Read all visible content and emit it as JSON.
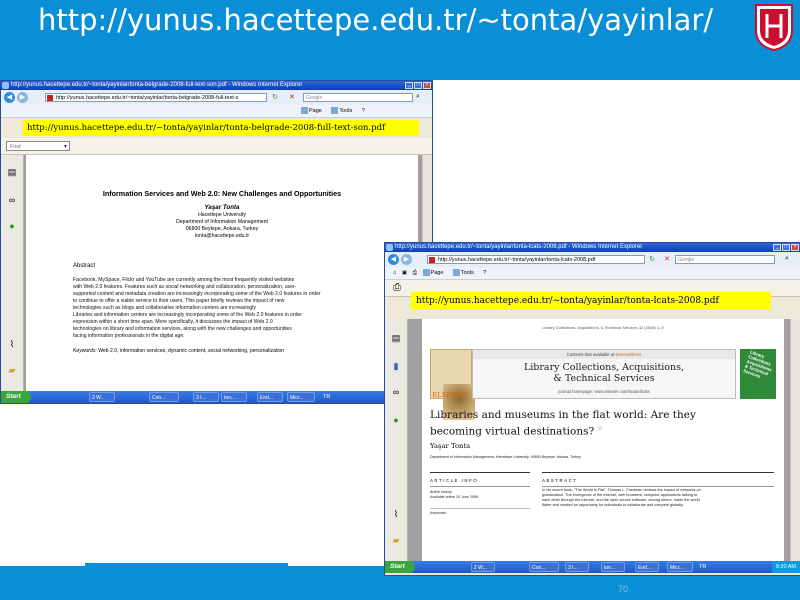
{
  "slide": {
    "title": "http://yunus.hacettepe.edu.tr/~tonta/yayinlar/",
    "page_number": "70"
  },
  "colors": {
    "header_blue": "#0a8ed6",
    "banner_yellow": "#ffff00",
    "logo_red": "#c8102e"
  },
  "window1": {
    "title": "http://yunus.hacettepe.edu.tr/~tonta/yayinlar/tonta-belgrade-2008-full-text-son.pdf - Windows Internet Explorer",
    "address": "http://yunus.hacettepe.edu.tr/~tonta/yayinlar/tonta-belgrade-2008-full-text-s",
    "search_placeholder": "Google",
    "banner_url": "http://yunus.hacettepe.edu.tr/~tonta/yayinlar/tonta-belgrade-2008-full-text-son.pdf",
    "find_placeholder": "Find",
    "toolbar": {
      "page": "Page",
      "tools": "Tools"
    },
    "paper": {
      "title": "Information Services and Web 2.0: New Challenges and Opportunities",
      "author": "Yaşar Tonta",
      "affiliation": [
        "Hacettepe University",
        "Department of Information Management",
        "06800 Beytepe, Ankara, Turkey",
        "tonta@hacettepe.edu.tr"
      ],
      "abstract_heading": "Abstract",
      "abstract_lines": [
        "Facebook, MySpace, Flickr and YouTube are currently among the most frequently visited websites",
        "with Web 2.0 features.  Features such as social networking and collaboration, personalization, user-",
        "supported content and metadata creation are increasingly incorporating some of the Web 2.0 features in order",
        "to continue to offer a viable service to their users.  This paper briefly reviews the impact of new",
        "technologies such as blogs and collaborative information centers are increasingly",
        "Libraries and information centers are increasingly incorporating some of the Web 2.0 features in order",
        "expression within a short time span.  More specifically, it discusses the impact of Web 2.0",
        "technologies on library and information services, along with the new challenges and opportunities",
        "facing information professionals in the digital age."
      ],
      "keywords_label": "Keywords:",
      "keywords": "Web 2.0, information services, dynamic content, social networking, personalization"
    },
    "taskbar": {
      "start": "Start",
      "items": [
        "2 W...",
        "Con...",
        "3 I...",
        "ton...",
        "End...",
        "Micr..."
      ],
      "lang": "TR"
    }
  },
  "window2": {
    "title": "http://yunus.hacettepe.edu.tr/~tonta/yayinlar/tonta-lcats-2008.pdf - Windows Internet Explorer",
    "address": "http://yunus.hacettepe.edu.tr/~tonta/yayinlar/tonta-lcats-2008.pdf",
    "search_placeholder": "Google",
    "banner_url": "http://yunus.hacettepe.edu.tr/~tonta/yayinlar/tonta-lcats-2008.pdf",
    "toolbar": {
      "page": "Page",
      "tools": "Tools"
    },
    "article": {
      "journal_ref": "Library Collections, Acquisitions, & Technical Services 32 (2008) 1–9",
      "contents_prefix": "Contents lists available at",
      "contents_link": "ScienceDirect",
      "journal_title_line1": "Library Collections, Acquisitions,",
      "journal_title_line2": "& Technical Services",
      "journal_homepage": "journal homepage: www.elsevier.com/locate/lcats",
      "publisher": "ELSEVIER",
      "cover_text": "Library Collections Acquisitions & Technical Services",
      "title": "Libraries and museums in the flat world: Are they becoming virtual destinations?",
      "title_mark": "☆",
      "author": "Yaşar Tonta",
      "department": "Department of Information Management, Hacettepe University, 06800 Beytepe, Ankara, Turkey",
      "article_info_label": "ARTICLE   INFO",
      "abstract_label": "ABSTRACT",
      "history": [
        "Article history:",
        "Available online 24 June 2008"
      ],
      "keywords_label": "Keywords:",
      "abstract_lines": [
        "In his recent book, \"The World is Flat\", Thomas L. Friedman reviews the impact of networks on",
        "globalization. The emergence of the Internet, web browsers, computer applications talking to",
        "each other through the Internet, and the open source software, among others, made the world",
        "flatter and created an opportunity for individuals to collaborate and compete globally."
      ]
    },
    "taskbar": {
      "start": "Start",
      "items": [
        "2 W...",
        "Con...",
        "3 I...",
        "ton...",
        "End...",
        "Micr..."
      ],
      "lang": "TR",
      "clock": "8:20 AM"
    }
  }
}
